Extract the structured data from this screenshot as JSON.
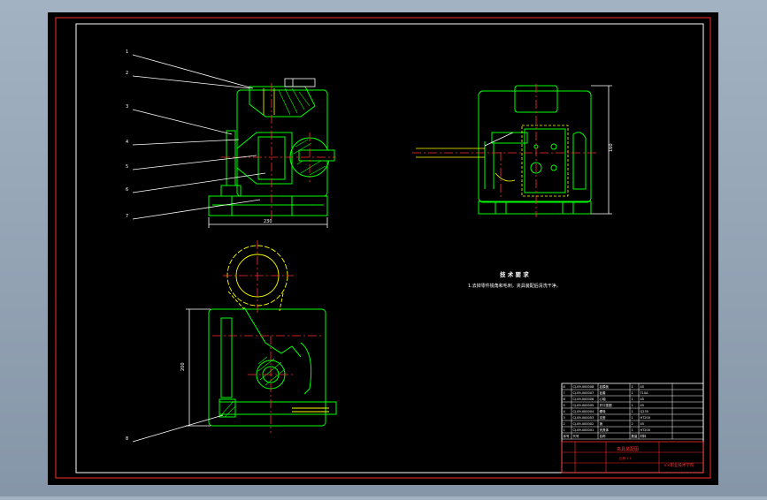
{
  "drawing": {
    "background": "#000000",
    "frame_color": "#ff2a2a",
    "geometry_color": "#00ff00",
    "centerline_color": "#ff3030",
    "annotation_color": "#ffffff",
    "hidden_line_color": "#ffff00"
  },
  "tech_requirements": {
    "title": "技 术 要 求",
    "body": "1.去掉零件锐角和毛刺，夹具装配后清洗干净。"
  },
  "front_view": {
    "part_labels": [
      "1",
      "2",
      "3",
      "4",
      "5",
      "6",
      "7"
    ],
    "dimension_text": "230"
  },
  "side_view": {
    "dimension_text": "160"
  },
  "top_view": {
    "part_label": "8",
    "dimension_text": "200"
  },
  "title_block": {
    "drawing_name": "夹具装配图",
    "scale_row": "比例  1:1",
    "school": "××职业技术学院",
    "rows": [
      {
        "no": "8",
        "code": "CJ-09-000008",
        "name": "钻模板",
        "qty": "1",
        "material": "45"
      },
      {
        "no": "7",
        "code": "CJ-09-000007",
        "name": "钻套",
        "qty": "1",
        "material": "T10A"
      },
      {
        "no": "6",
        "code": "CJ-09-000006",
        "name": "心轴",
        "qty": "1",
        "material": "45"
      },
      {
        "no": "5",
        "code": "CJ-09-000005",
        "name": "开口垫圈",
        "qty": "1",
        "material": "45"
      },
      {
        "no": "4",
        "code": "CJ-09-000004",
        "name": "螺母",
        "qty": "1",
        "material": "Q235"
      },
      {
        "no": "3",
        "code": "CJ-09-000003",
        "name": "支座",
        "qty": "1",
        "material": "HT200"
      },
      {
        "no": "2",
        "code": "CJ-09-000002",
        "name": "销",
        "qty": "2",
        "material": "45"
      },
      {
        "no": "1",
        "code": "CJ-09-000001",
        "name": "夹具体",
        "qty": "1",
        "material": "HT200"
      }
    ],
    "header": {
      "no": "序号",
      "code": "代号",
      "name": "名称",
      "qty": "数量",
      "material": "材料"
    }
  }
}
